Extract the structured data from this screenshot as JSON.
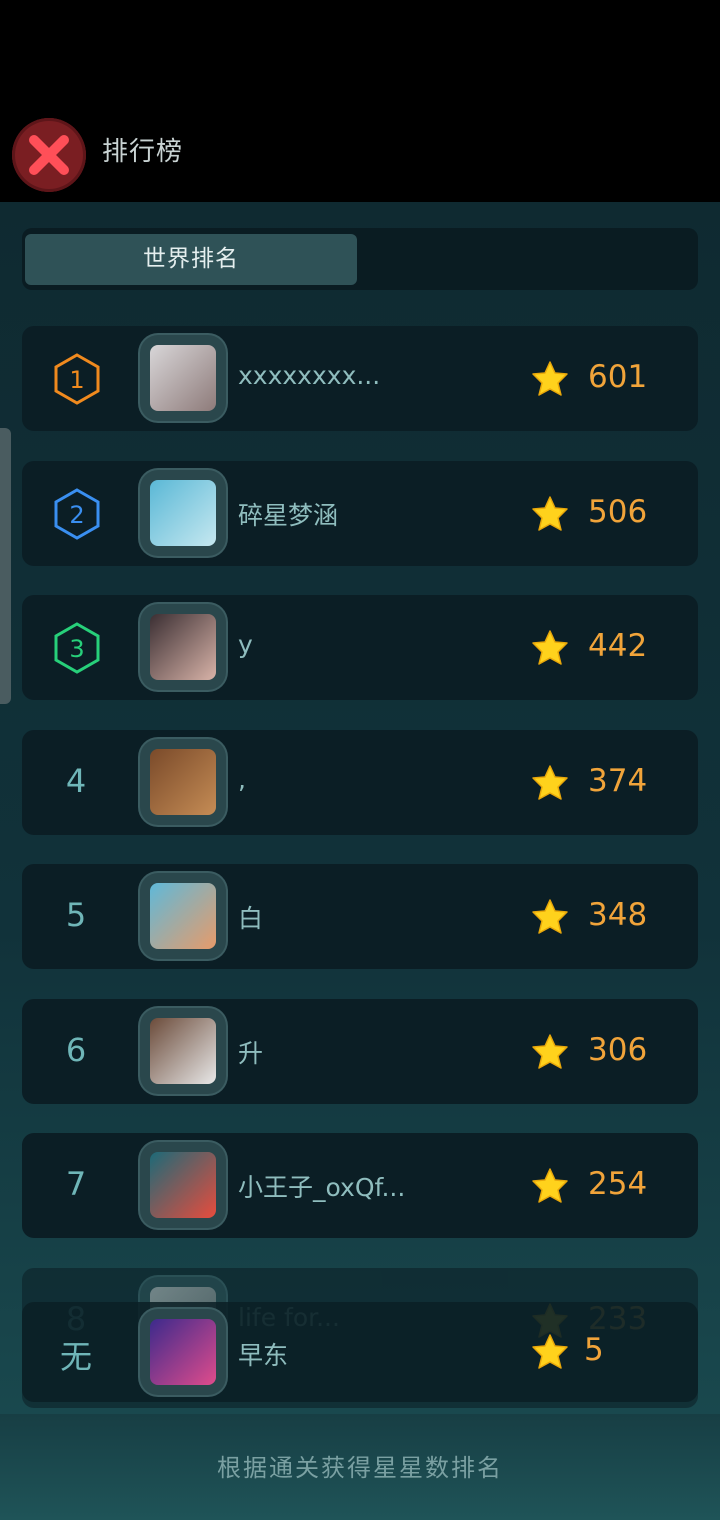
{
  "header": {
    "title": "排行榜",
    "close_icon": "close-x-icon"
  },
  "tabs": [
    {
      "label": "世界排名",
      "active": true
    }
  ],
  "rankings": [
    {
      "rank": "1",
      "badge": true,
      "badge_color": "#f08a1e",
      "name": "xxxxxxxx...",
      "score": "601",
      "avatar_colors": [
        "#d8d6d8",
        "#8e7b7a"
      ]
    },
    {
      "rank": "2",
      "badge": true,
      "badge_color": "#3a8ff0",
      "name": "碎星梦涵",
      "score": "506",
      "avatar_colors": [
        "#5ab8d6",
        "#c6e8f0"
      ]
    },
    {
      "rank": "3",
      "badge": true,
      "badge_color": "#27d07a",
      "name": "y",
      "score": "442",
      "avatar_colors": [
        "#3b2f33",
        "#d8b3a8"
      ]
    },
    {
      "rank": "4",
      "badge": false,
      "name": ",",
      "score": "374",
      "avatar_colors": [
        "#7a4a2a",
        "#c58c55"
      ]
    },
    {
      "rank": "5",
      "badge": false,
      "name": "白",
      "score": "348",
      "avatar_colors": [
        "#5fb9d9",
        "#e79b6a"
      ]
    },
    {
      "rank": "6",
      "badge": false,
      "name": "升",
      "score": "306",
      "avatar_colors": [
        "#6b4b3a",
        "#e8e8e8"
      ]
    },
    {
      "rank": "7",
      "badge": false,
      "name": "小王子_oxQf...",
      "score": "254",
      "avatar_colors": [
        "#1c6a78",
        "#e84c3d"
      ]
    },
    {
      "rank": "8",
      "badge": false,
      "name": "life for...",
      "score": "233",
      "avatar_colors": [
        "#bcbcbc",
        "#777"
      ]
    }
  ],
  "my_rank": {
    "rank": "无",
    "name": "早东",
    "score": "5",
    "avatar_colors": [
      "#3c2a8c",
      "#e04c8c"
    ]
  },
  "footer": {
    "note": "根据通关获得星星数排名"
  },
  "colors": {
    "accent_gold": "#f1a43a",
    "star": "#ffd21c",
    "rank_text": "#6fb6b8"
  }
}
